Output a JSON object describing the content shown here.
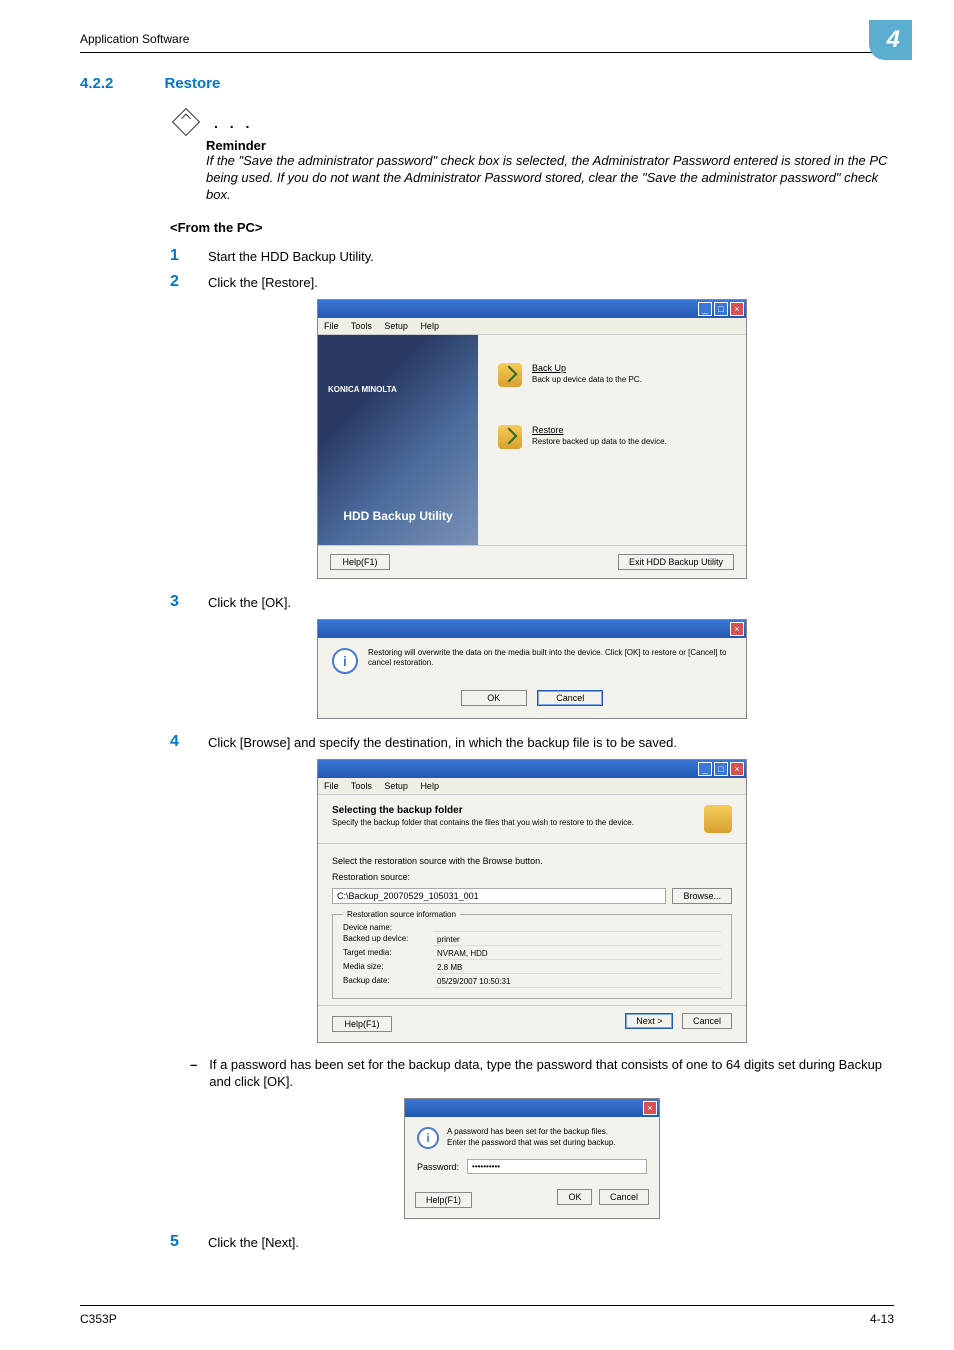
{
  "header": {
    "text": "Application Software",
    "chapter_number": "4"
  },
  "section": {
    "number": "4.2.2",
    "title": "Restore"
  },
  "reminder": {
    "dots": ". . .",
    "label": "Reminder",
    "body": "If the \"Save the administrator password\" check box is selected, the Administrator Password entered is stored in the PC being used. If you do not want the Administrator Password stored, clear the \"Save the administrator password\" check box."
  },
  "from_pc_heading": "<From the PC>",
  "steps": {
    "s1": {
      "n": "1",
      "t": "Start the HDD Backup Utility."
    },
    "s2": {
      "n": "2",
      "t": "Click the [Restore]."
    },
    "s3": {
      "n": "3",
      "t": "Click the [OK]."
    },
    "s4": {
      "n": "4",
      "t": "Click [Browse] and specify the destination, in which the backup file is to be saved."
    },
    "s4_sub": "If a password has been set for the backup data, type the password that consists of one to 64 digits set during Backup and click [OK].",
    "s5": {
      "n": "5",
      "t": "Click the [Next]."
    }
  },
  "win1": {
    "menu": {
      "file": "File",
      "tools": "Tools",
      "setup": "Setup",
      "help": "Help"
    },
    "brand": "KONICA MINOLTA",
    "title": "HDD Backup Utility",
    "backup": {
      "title": "Back Up",
      "desc": "Back up device data to the PC."
    },
    "restore": {
      "title": "Restore",
      "desc": "Restore backed up data to the device."
    },
    "help_btn": "Help(F1)",
    "exit_btn": "Exit HDD Backup Utility"
  },
  "win2": {
    "msg": "Restoring will overwrite the data on the media built into the device. Click [OK] to restore or [Cancel] to cancel restoration.",
    "ok": "OK",
    "cancel": "Cancel"
  },
  "win3": {
    "menu": {
      "file": "File",
      "tools": "Tools",
      "setup": "Setup",
      "help": "Help"
    },
    "head_title": "Selecting the backup folder",
    "head_desc": "Specify the backup folder that contains the files that you wish to restore to the device.",
    "instruct": "Select the restoration source with the Browse button.",
    "src_label": "Restoration source:",
    "src_path": "C:\\Backup_20070529_105031_001",
    "browse": "Browse...",
    "fieldset_title": "Restoration source information",
    "rows": {
      "device_label": "Device name:",
      "device_val": "",
      "backed_label": "Backed up device:",
      "backed_val": "printer",
      "media_label": "Target media:",
      "media_val": "NVRAM, HDD",
      "size_label": "Media size:",
      "size_val": "2.8 MB",
      "date_label": "Backup date:",
      "date_val": "05/29/2007 10:50:31"
    },
    "help_btn": "Help(F1)",
    "next_btn": "Next >",
    "cancel_btn": "Cancel"
  },
  "win4": {
    "msg1": "A password has been set for the backup files.",
    "msg2": "Enter the password that was set during backup.",
    "pw_label": "Password:",
    "pw_value": "••••••••••",
    "help_btn": "Help(F1)",
    "ok": "OK",
    "cancel": "Cancel"
  },
  "footer": {
    "left": "C353P",
    "right": "4-13"
  }
}
